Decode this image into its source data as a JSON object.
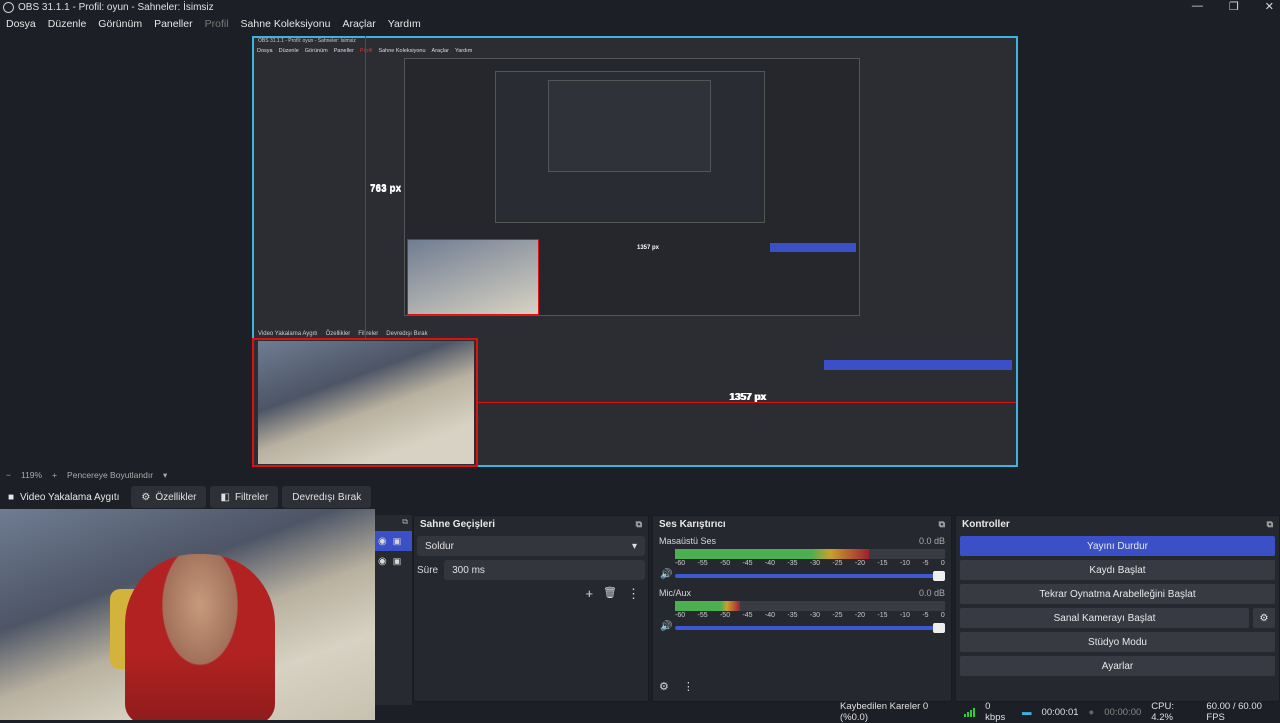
{
  "window": {
    "title": "OBS 31.1.1 - Profil: oyun - Sahneler: İsimsiz",
    "controls": [
      "—",
      "❐",
      "✕"
    ]
  },
  "menu": [
    "Dosya",
    "Düzenle",
    "Görünüm",
    "Paneller",
    "Profil",
    "Sahne Koleksiyonu",
    "Araçlar",
    "Yardım"
  ],
  "preview": {
    "measure_vertical": "763 px",
    "measure_horizontal": "1357 px",
    "zoom": "119%",
    "scale_mode": "Pencereye Boyutlandır",
    "nested_title": "OBS 31.1.1 - Profil: oyun - Sahneler: İsimsiz",
    "nested_measure_v": "763 px",
    "nested_measure_h": "1357 px"
  },
  "source_bar": {
    "source_name": "Video Yakalama Aygıtı",
    "properties": "Özellikler",
    "filters": "Filtreler",
    "deactivate": "Devredışı Bırak"
  },
  "transitions": {
    "title": "Sahne Geçişleri",
    "selected": "Soldur",
    "duration_label": "Süre",
    "duration_value": "300 ms"
  },
  "mixer": {
    "title": "Ses Karıştırıcı",
    "scale": [
      "-60",
      "-55",
      "-50",
      "-45",
      "-40",
      "-35",
      "-30",
      "-25",
      "-20",
      "-15",
      "-10",
      "-5",
      "0"
    ],
    "channels": [
      {
        "name": "Masaüstü Ses",
        "db": "0.0 dB",
        "level": 0.72
      },
      {
        "name": "Mic/Aux",
        "db": "0.0 dB",
        "level": 0.24
      }
    ]
  },
  "controls": {
    "title": "Kontroller",
    "buttons": [
      "Yayını Durdur",
      "Kaydı Başlat",
      "Tekrar Oynatma Arabelleğini Başlat",
      "Sanal Kamerayı Başlat",
      "Stüdyo Modu",
      "Ayarlar"
    ]
  },
  "status": {
    "dropped": "Kaybedilen Kareler 0 (%0.0)",
    "bitrate": "0 kbps",
    "stream_time": "00:00:01",
    "rec_time": "00:00:00",
    "cpu": "CPU: 4.2%",
    "fps": "60.00 / 60.00 FPS"
  },
  "colors": {
    "accent": "#3b50c7",
    "selection": "#3db4e0",
    "guide": "#dd1111",
    "meter_green": "#4caf50",
    "meter_yellow": "#c8a030",
    "meter_red": "#a02030"
  }
}
